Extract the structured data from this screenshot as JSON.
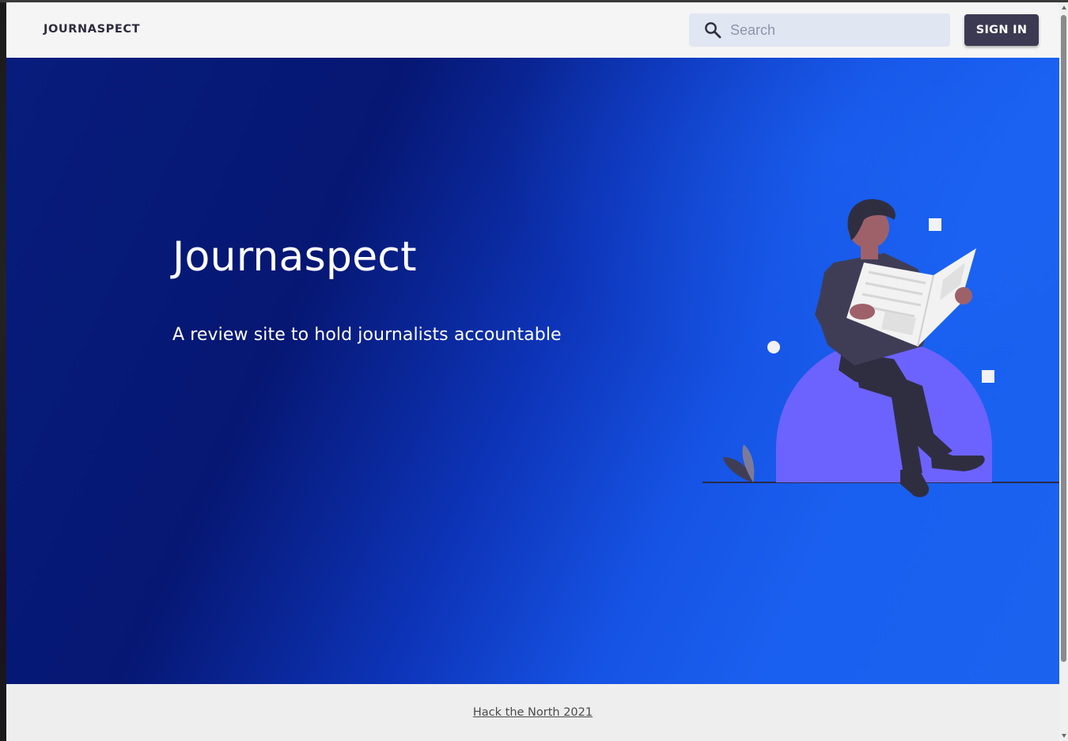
{
  "navbar": {
    "brand": "JOURNASPECT",
    "search_placeholder": "Search",
    "search_value": "",
    "signin_label": "SIGN IN"
  },
  "hero": {
    "title": "Journaspect",
    "subtitle": "A review site to hold journalists accountable",
    "illustration_icon": "man-reading-newspaper-illustration"
  },
  "footer": {
    "link_text": "Hack the North 2021"
  },
  "colors": {
    "navbar_bg": "#f5f5f5",
    "search_bg": "#e1e6f3",
    "button_bg": "#3c3a52",
    "hero_dark": "#061773",
    "hero_light": "#1b62ef",
    "accent_purple": "#6c63ff",
    "footer_bg": "#eeeeee"
  }
}
